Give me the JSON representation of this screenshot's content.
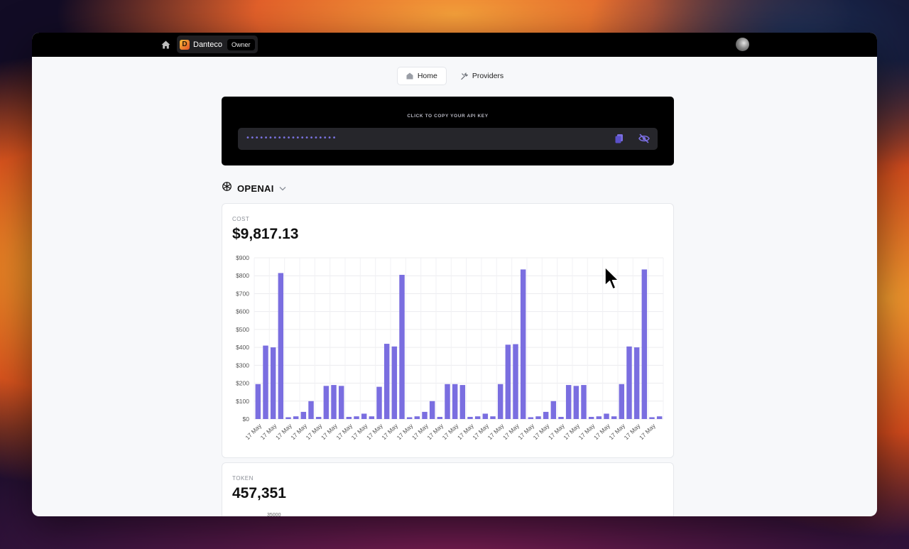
{
  "topbar": {
    "org_initial": "D",
    "org_name": "Danteco",
    "role": "Owner"
  },
  "tabs": [
    {
      "label": "Home",
      "icon": "home-tab-icon",
      "active": true
    },
    {
      "label": "Providers",
      "icon": "tools-icon",
      "active": false
    }
  ],
  "api_key": {
    "label": "CLICK TO COPY YOUR API KEY",
    "masked_value": "••••••••••••••••••••"
  },
  "provider": {
    "name": "OPENAI"
  },
  "cost_card": {
    "label": "COST",
    "value": "$9,817.13"
  },
  "token_card": {
    "label": "TOKEN",
    "value": "457,351",
    "first_tick": "35000"
  },
  "colors": {
    "bar": "#7a6ee0",
    "accent": "#6f63de"
  },
  "chart_data": {
    "type": "bar",
    "ylim": [
      0,
      900
    ],
    "yticks": [
      "$0",
      "$100",
      "$200",
      "$300",
      "$400",
      "$500",
      "$600",
      "$700",
      "$800",
      "$900"
    ],
    "grid": true,
    "x_tick_label": "17 May",
    "values": [
      195,
      410,
      400,
      815,
      10,
      15,
      40,
      100,
      12,
      185,
      190,
      185,
      12,
      15,
      30,
      15,
      180,
      420,
      405,
      805,
      10,
      15,
      40,
      100,
      12,
      195,
      195,
      190,
      12,
      15,
      30,
      15,
      195,
      415,
      418,
      835,
      10,
      15,
      40,
      100,
      12,
      190,
      185,
      190,
      12,
      15,
      30,
      15,
      195,
      405,
      400,
      835,
      10,
      15
    ]
  }
}
